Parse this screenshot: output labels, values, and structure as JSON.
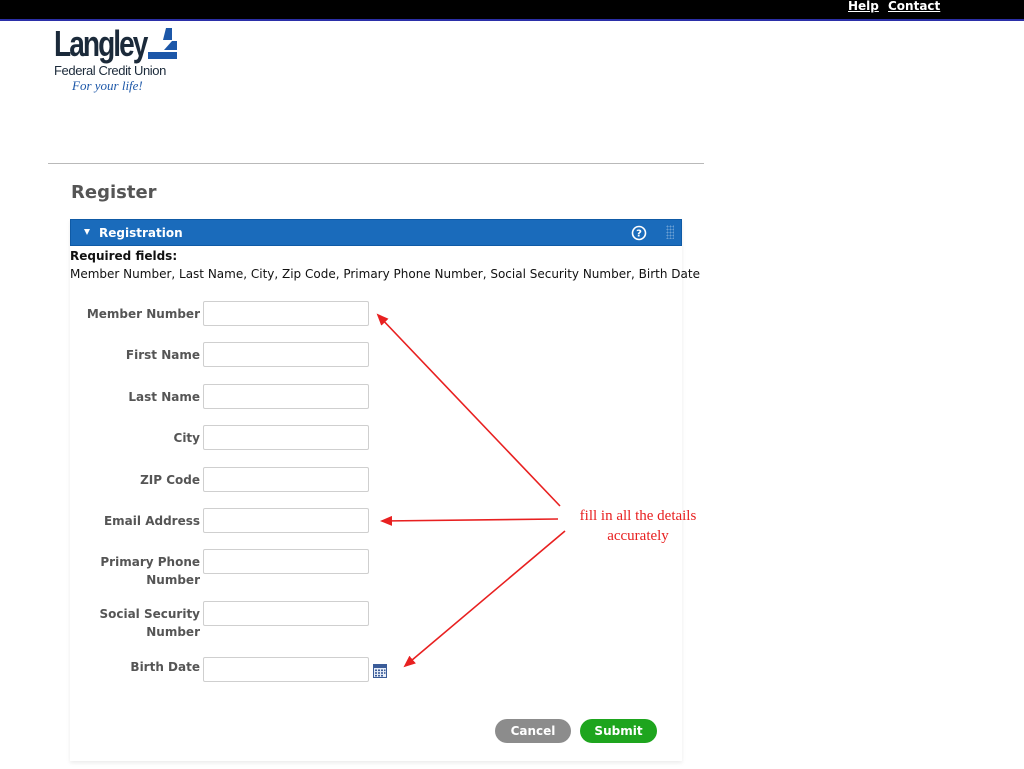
{
  "topnav": {
    "help": "Help",
    "contact": "Contact"
  },
  "logo": {
    "name": "Langley",
    "subtitle": "Federal Credit Union",
    "tagline": "For your life!"
  },
  "page": {
    "title": "Register"
  },
  "panel": {
    "title": "Registration",
    "required_label": "Required fields:",
    "required_list": "Member Number, Last Name, City, Zip Code, Primary Phone Number, Social Security Number, Birth Date"
  },
  "fields": [
    {
      "label": "Member Number",
      "value": ""
    },
    {
      "label": "First Name",
      "value": ""
    },
    {
      "label": "Last Name",
      "value": ""
    },
    {
      "label": "City",
      "value": ""
    },
    {
      "label": "ZIP Code",
      "value": ""
    },
    {
      "label": "Email Address",
      "value": ""
    },
    {
      "label_line1": "Primary Phone",
      "label_line2": "Number",
      "value": ""
    },
    {
      "label_line1": "Social Security",
      "label_line2": "Number",
      "value": ""
    },
    {
      "label": "Birth Date",
      "value": ""
    }
  ],
  "buttons": {
    "cancel": "Cancel",
    "submit": "Submit"
  },
  "annotation": {
    "line1": "fill in all the details",
    "line2": "accurately",
    "color": "#e82020"
  },
  "colors": {
    "header_blue": "#1a6bbb",
    "submit_green": "#1ea51e",
    "cancel_gray": "#8c8c8c"
  }
}
